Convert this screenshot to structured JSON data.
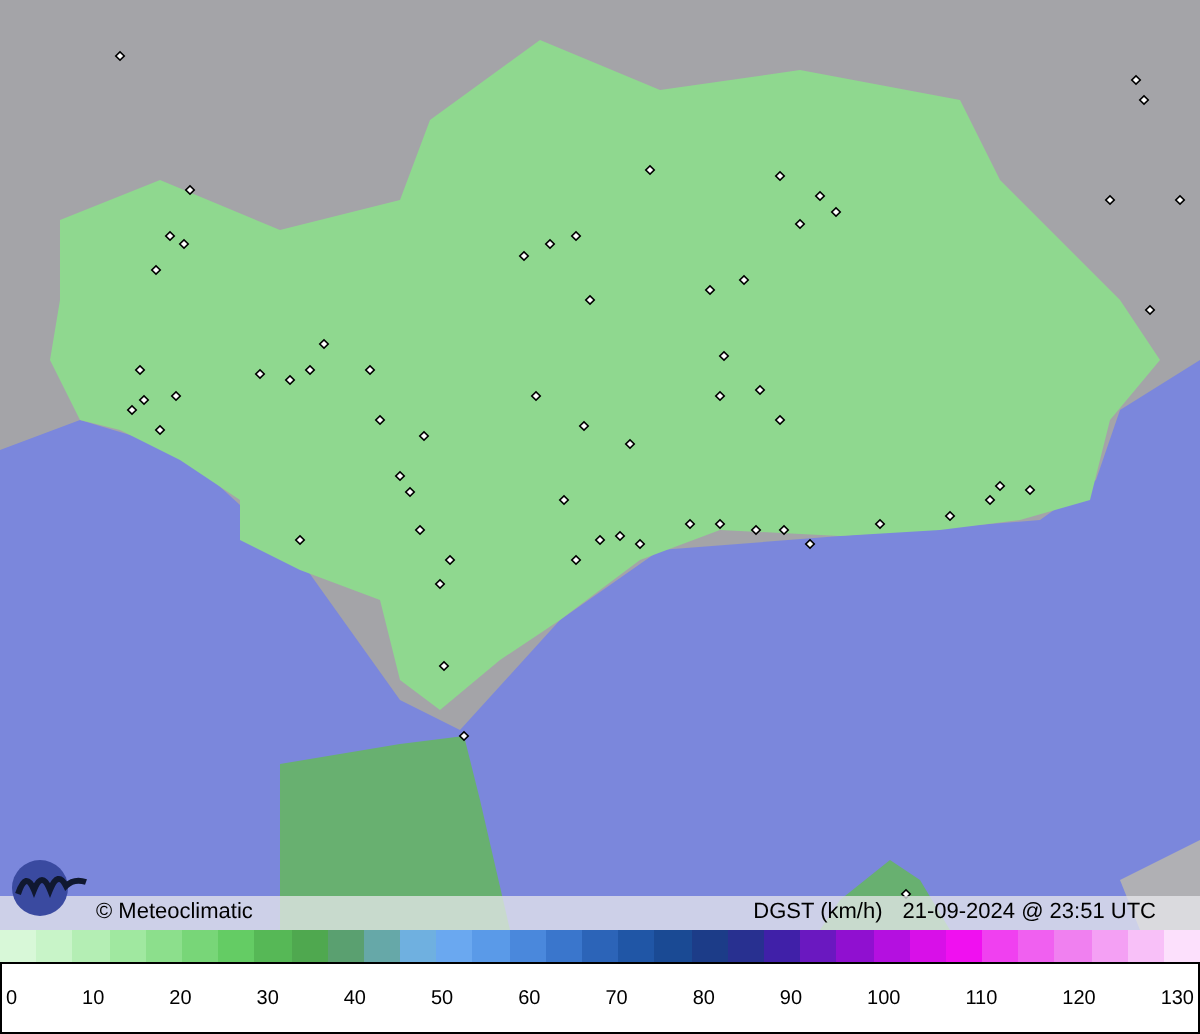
{
  "map": {
    "credit": "© Meteoclimatic",
    "variable": "DGST (km/h)",
    "timestamp": "21-09-2024 @ 23:51 UTC"
  },
  "legend": {
    "ticks": [
      "0",
      "10",
      "20",
      "30",
      "40",
      "50",
      "60",
      "70",
      "80",
      "90",
      "100",
      "110",
      "120",
      "130"
    ]
  }
}
